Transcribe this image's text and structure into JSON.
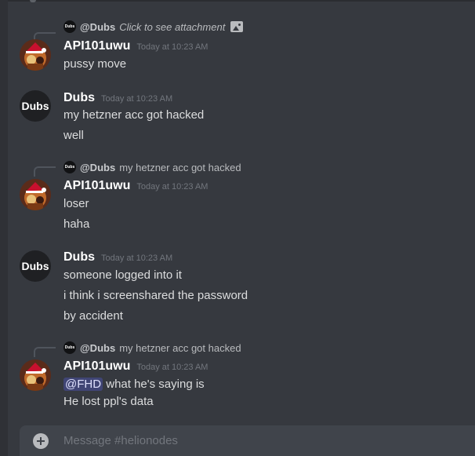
{
  "channel": {
    "composer_placeholder": "Message #helionodes"
  },
  "messages": [
    {
      "reply": {
        "avatar_text": "Dubs",
        "author": "@Dubs",
        "text": "Click to see attachment",
        "icon": "image-icon"
      },
      "author": "API101uwu",
      "timestamp": "Today at 10:23 AM",
      "lines": [
        "pussy move"
      ]
    },
    {
      "avatar_text": "Dubs",
      "author": "Dubs",
      "timestamp": "Today at 10:23 AM",
      "lines": [
        "my hetzner acc got hacked",
        "well"
      ]
    },
    {
      "reply": {
        "avatar_text": "Dubs",
        "author": "@Dubs",
        "text": "my hetzner acc got hacked"
      },
      "author": "API101uwu",
      "timestamp": "Today at 10:23 AM",
      "lines": [
        "loser",
        "haha"
      ]
    },
    {
      "avatar_text": "Dubs",
      "author": "Dubs",
      "timestamp": "Today at 10:23 AM",
      "lines": [
        "someone logged into it",
        "i think i screenshared the password",
        "by accident"
      ]
    },
    {
      "reply": {
        "avatar_text": "Dubs",
        "author": "@Dubs",
        "text": "my hetzner acc got hacked"
      },
      "author": "API101uwu",
      "timestamp": "Today at 10:23 AM",
      "mention": "@FHD",
      "lines": [
        "what he's saying is",
        "He lost ppl's data"
      ]
    }
  ]
}
